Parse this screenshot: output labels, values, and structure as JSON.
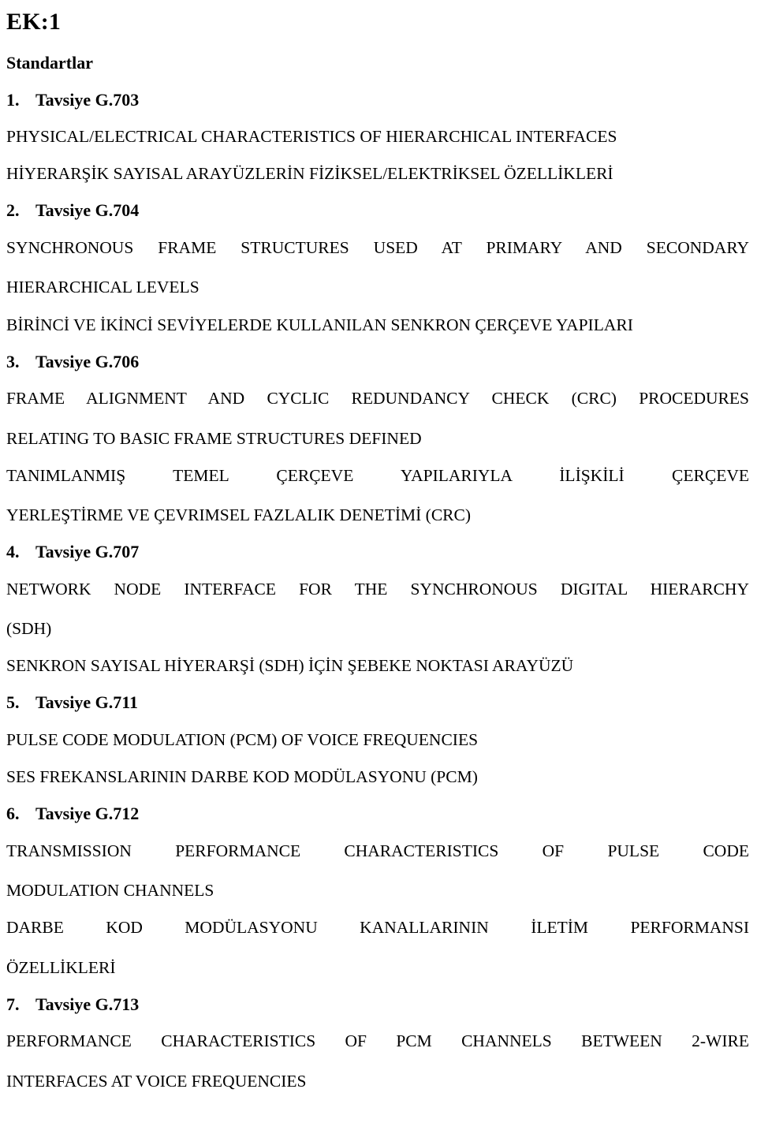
{
  "document": {
    "title": "EK:1",
    "subtitle": "Standartlar"
  },
  "standards": [
    {
      "number": "1.",
      "name": "Tavsiye G.703",
      "en_lines": [
        "PHYSICAL/ELECTRICAL CHARACTERISTICS OF HIERARCHICAL INTERFACES"
      ],
      "tr_lines": [
        "HİYERARŞİK SAYISAL ARAYÜZLERİN FİZİKSEL/ELEKTRİKSEL ÖZELLİKLERİ"
      ]
    },
    {
      "number": "2.",
      "name": "Tavsiye G.704",
      "en_lines": [
        "SYNCHRONOUS FRAME STRUCTURES USED AT PRIMARY AND SECONDARY",
        "HIERARCHICAL LEVELS"
      ],
      "tr_lines": [
        "BİRİNCİ VE İKİNCİ SEVİYELERDE KULLANILAN SENKRON ÇERÇEVE YAPILARI"
      ]
    },
    {
      "number": "3.",
      "name": "Tavsiye G.706",
      "en_lines": [
        "FRAME ALIGNMENT AND CYCLIC REDUNDANCY CHECK (CRC) PROCEDURES",
        "RELATING TO BASIC FRAME STRUCTURES DEFINED"
      ],
      "tr_lines": [
        "TANIMLANMIŞ TEMEL ÇERÇEVE YAPILARIYLA İLİŞKİLİ ÇERÇEVE",
        "YERLEŞTİRME VE ÇEVRIMSEL FAZLALIK DENETİMİ (CRC)"
      ]
    },
    {
      "number": "4.",
      "name": "Tavsiye G.707",
      "en_lines": [
        "NETWORK NODE INTERFACE FOR THE SYNCHRONOUS DIGITAL HIERARCHY",
        "(SDH)"
      ],
      "tr_lines": [
        "SENKRON SAYISAL HİYERARŞİ  (SDH) İÇİN ŞEBEKE NOKTASI ARAYÜZÜ"
      ]
    },
    {
      "number": "5.",
      "name": "Tavsiye G.711",
      "en_lines": [
        "PULSE CODE MODULATION (PCM) OF VOICE FREQUENCIES"
      ],
      "tr_lines": [
        "SES FREKANSLARININ DARBE KOD MODÜLASYONU (PCM)"
      ]
    },
    {
      "number": "6.",
      "name": "Tavsiye G.712",
      "en_lines": [
        "TRANSMISSION PERFORMANCE CHARACTERISTICS OF PULSE CODE",
        "MODULATION CHANNELS"
      ],
      "tr_lines": [
        "DARBE KOD MODÜLASYONU KANALLARININ İLETİM PERFORMANSI",
        "ÖZELLİKLERİ"
      ]
    },
    {
      "number": "7.",
      "name": "Tavsiye G.713",
      "en_lines": [
        "PERFORMANCE CHARACTERISTICS OF PCM CHANNELS BETWEEN 2-WIRE",
        "INTERFACES AT VOICE FREQUENCIES"
      ],
      "tr_lines": []
    }
  ]
}
